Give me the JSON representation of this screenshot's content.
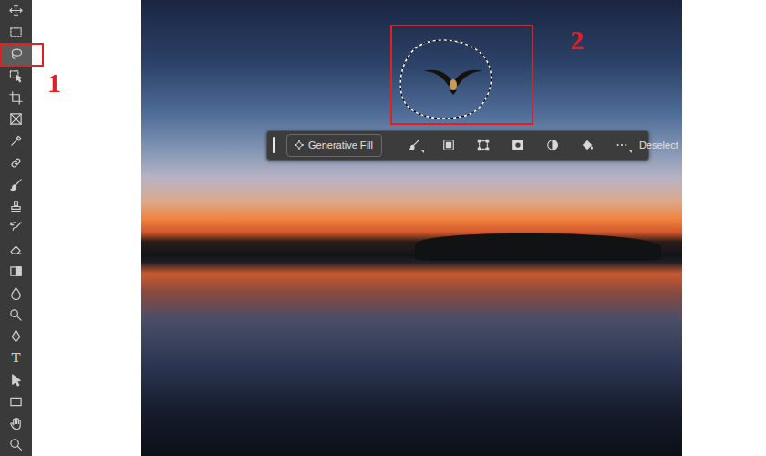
{
  "toolbar": {
    "tools": [
      {
        "kind": "move",
        "selected": false
      },
      {
        "kind": "marquee",
        "selected": false
      },
      {
        "kind": "lasso",
        "selected": true
      },
      {
        "kind": "object-select",
        "selected": false
      },
      {
        "kind": "crop",
        "selected": false
      },
      {
        "kind": "frame",
        "selected": false
      },
      {
        "kind": "eyedropper",
        "selected": false
      },
      {
        "kind": "healing",
        "selected": false
      },
      {
        "kind": "brush",
        "selected": false
      },
      {
        "kind": "stamp",
        "selected": false
      },
      {
        "kind": "history-brush",
        "selected": false
      },
      {
        "kind": "eraser",
        "selected": false
      },
      {
        "kind": "gradient",
        "selected": false
      },
      {
        "kind": "blur",
        "selected": false
      },
      {
        "kind": "dodge",
        "selected": false
      },
      {
        "kind": "pen",
        "selected": false
      },
      {
        "kind": "type",
        "glyph": "T",
        "selected": false
      },
      {
        "kind": "path-select",
        "selected": false
      },
      {
        "kind": "rectangle",
        "selected": false
      },
      {
        "kind": "hand",
        "selected": false
      },
      {
        "kind": "zoom",
        "selected": false
      }
    ]
  },
  "annotations": [
    {
      "label": "1"
    },
    {
      "label": "2"
    }
  ],
  "context_bar": {
    "generative_fill": "Generative Fill",
    "tools": [
      {
        "kind": "brush",
        "dropdown": true
      },
      {
        "kind": "mask",
        "dropdown": false
      },
      {
        "kind": "transform",
        "dropdown": false
      },
      {
        "kind": "layer-mask",
        "dropdown": false
      },
      {
        "kind": "invert",
        "dropdown": false
      },
      {
        "kind": "fill",
        "dropdown": false
      },
      {
        "kind": "more",
        "dropdown": true
      }
    ],
    "deselect": "Deselect"
  }
}
